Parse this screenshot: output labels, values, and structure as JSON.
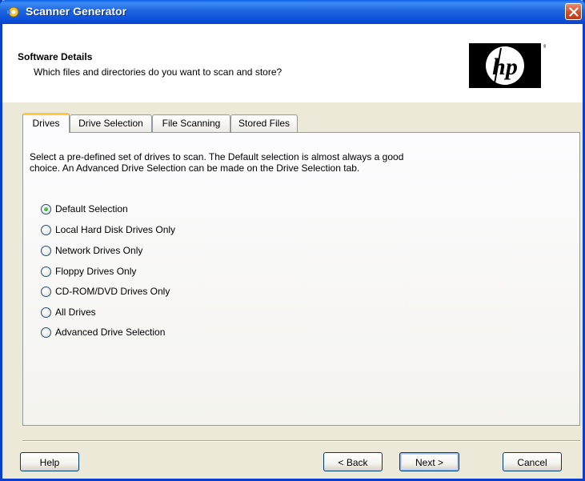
{
  "window": {
    "title": "Scanner Generator"
  },
  "header": {
    "title": "Software Details",
    "subtitle": "Which files and directories do you want to scan and store?",
    "logo_text": "hp"
  },
  "tabs": [
    {
      "label": "Drives",
      "active": true
    },
    {
      "label": "Drive Selection",
      "active": false
    },
    {
      "label": "File Scanning",
      "active": false
    },
    {
      "label": "Stored Files",
      "active": false
    }
  ],
  "panel": {
    "intro_line1": "Select a pre-defined set of drives to scan.  The Default selection is almost always a good",
    "intro_line2": "choice.  An Advanced Drive Selection can be made on the Drive Selection tab.",
    "options": [
      {
        "label": "Default Selection",
        "checked": true
      },
      {
        "label": "Local Hard Disk Drives Only",
        "checked": false
      },
      {
        "label": "Network Drives Only",
        "checked": false
      },
      {
        "label": "Floppy Drives Only",
        "checked": false
      },
      {
        "label": "CD-ROM/DVD Drives Only",
        "checked": false
      },
      {
        "label": "All Drives",
        "checked": false
      },
      {
        "label": "Advanced Drive Selection",
        "checked": false
      }
    ]
  },
  "buttons": {
    "help": "Help",
    "back": "< Back",
    "next": "Next >",
    "cancel": "Cancel"
  },
  "colors": {
    "titlebar": "#0A5FE8",
    "tab_highlight": "#FFC83C",
    "dialog_bg": "#ECE9D8",
    "radio_selected": "#21A121"
  },
  "icons": {
    "app": "scanner-generator-icon",
    "close": "close-icon"
  }
}
